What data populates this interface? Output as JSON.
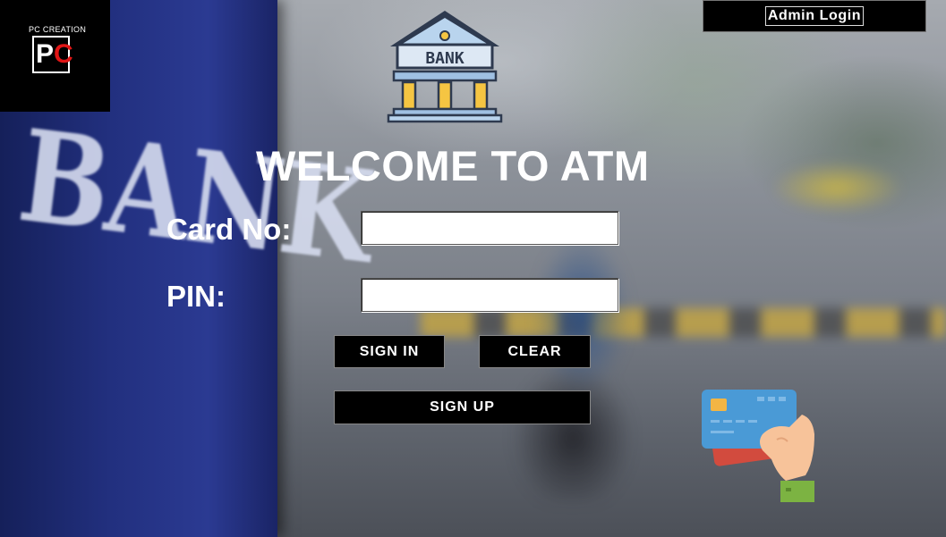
{
  "logo": {
    "caption": "PC CREATION",
    "letter_p": "P",
    "letter_c": "C"
  },
  "header": {
    "admin_login_label": "Admin Login"
  },
  "bank_icon": {
    "text": "BANK"
  },
  "background": {
    "sign_text": "BANK"
  },
  "main": {
    "title": "WELCOME TO ATM",
    "card_label": "Card No:",
    "card_value": "",
    "pin_label": "PIN:",
    "pin_value": ""
  },
  "buttons": {
    "sign_in": "SIGN IN",
    "clear": "CLEAR",
    "sign_up": "SIGN UP"
  },
  "icons": {
    "bank": "bank-building-icon",
    "card": "credit-card-in-hand-icon"
  },
  "colors": {
    "button_bg": "#000000",
    "text": "#ffffff",
    "logo_accent": "#e01515"
  }
}
